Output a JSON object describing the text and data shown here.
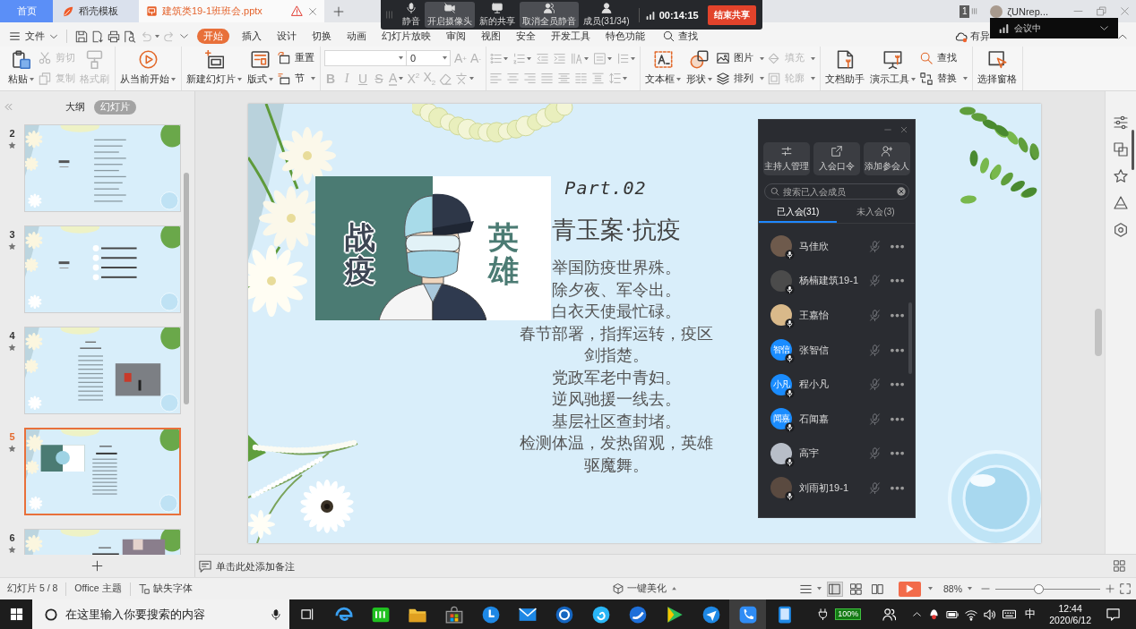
{
  "tabs": [
    {
      "kind": "home",
      "label": "首页",
      "selected": false,
      "warning": false
    },
    {
      "kind": "template",
      "label": "稻壳模板",
      "selected": false,
      "warning": false
    },
    {
      "kind": "document",
      "label": "建筑类19-1班班会.pptx",
      "selected": true,
      "warning": true
    }
  ],
  "account": {
    "badge": "1",
    "name": "ζUNrep..."
  },
  "meeting_bar": {
    "buttons": [
      {
        "label": "静音",
        "active": false
      },
      {
        "label": "开启摄像头",
        "active": true
      },
      {
        "label": "新的共享",
        "active": false
      },
      {
        "label": "取消全员静音",
        "active": true
      },
      {
        "label": "成员(31/34)",
        "active": false
      }
    ],
    "timer": "00:14:15",
    "end_button": "结束共享"
  },
  "meeting_status": "会议中",
  "menu": {
    "file": "文件",
    "quick_access": [
      {
        "disabled": false,
        "dropdown": false
      },
      {
        "disabled": false,
        "dropdown": false
      },
      {
        "disabled": false,
        "dropdown": false
      },
      {
        "disabled": false,
        "dropdown": false
      },
      {
        "disabled": true,
        "dropdown": true
      },
      {
        "disabled": true,
        "dropdown": false
      },
      {
        "disabled": false,
        "dropdown": false
      }
    ],
    "tabs": [
      {
        "label": "开始",
        "selected": true
      },
      {
        "label": "插入",
        "selected": false
      },
      {
        "label": "设计",
        "selected": false
      },
      {
        "label": "切换",
        "selected": false
      },
      {
        "label": "动画",
        "selected": false
      },
      {
        "label": "幻灯片放映",
        "selected": false
      },
      {
        "label": "审阅",
        "selected": false
      },
      {
        "label": "视图",
        "selected": false
      },
      {
        "label": "安全",
        "selected": false
      },
      {
        "label": "开发工具",
        "selected": false
      },
      {
        "label": "特色功能",
        "selected": false
      }
    ],
    "search": "查找",
    "cloud": "有异"
  },
  "ribbon": {
    "groups": [
      {
        "kind": "buttons",
        "items": [
          {
            "kind": "large",
            "label": "粘贴",
            "dropdown": true,
            "disabled": false
          },
          {
            "kind": "small",
            "label": "剪切",
            "dropdown": false,
            "disabled": true
          },
          {
            "kind": "small",
            "label": "复制",
            "dropdown": false,
            "disabled": true
          },
          {
            "kind": "large",
            "label": "格式刷",
            "dropdown": false,
            "disabled": true
          }
        ]
      },
      {
        "kind": "buttons",
        "items": [
          {
            "kind": "large",
            "label": "从当前开始",
            "dropdown": true,
            "disabled": false
          }
        ]
      },
      {
        "kind": "buttons",
        "items": [
          {
            "kind": "large",
            "label": "新建幻灯片",
            "dropdown": true,
            "disabled": false
          },
          {
            "kind": "large",
            "label": "版式",
            "dropdown": true,
            "disabled": false
          },
          {
            "kind": "small",
            "label": "重置",
            "dropdown": false,
            "disabled": false
          },
          {
            "kind": "small",
            "label": "节",
            "dropdown": true,
            "disabled": false
          }
        ]
      },
      {
        "kind": "font",
        "size": "0",
        "size_buttons": [
          {
            "label": "A$^{+}$",
            "disabled": true
          },
          {
            "label": "A$^{-}$",
            "disabled": true
          }
        ],
        "styles": [
          {
            "kind": "text",
            "label": "B",
            "dropdown": false,
            "disabled": true
          },
          {
            "kind": "text",
            "label": "I",
            "dropdown": false,
            "disabled": true
          },
          {
            "kind": "text",
            "label": "U",
            "dropdown": false,
            "disabled": true
          },
          {
            "kind": "text",
            "label": "S",
            "dropdown": false,
            "disabled": true
          },
          {
            "kind": "text",
            "label": "A",
            "dropdown": true,
            "disabled": true
          },
          {
            "kind": "text",
            "label": "X$^{2}$",
            "dropdown": false,
            "disabled": true
          },
          {
            "kind": "text",
            "label": "X$_{2}$",
            "dropdown": false,
            "disabled": true
          },
          {
            "kind": "icon",
            "dropdown": false,
            "disabled": true
          },
          {
            "kind": "icon",
            "dropdown": true,
            "disabled": true
          }
        ]
      },
      {
        "kind": "paragraph",
        "rows": [
          [
            {
              "dropdown": true,
              "disabled": true
            },
            {
              "dropdown": true,
              "disabled": true
            },
            {
              "dropdown": false,
              "disabled": true
            },
            {
              "dropdown": false,
              "disabled": true
            },
            {
              "dropdown": true,
              "disabled": true
            },
            {
              "dropdown": true,
              "disabled": true
            },
            {
              "dropdown": true,
              "disabled": true
            }
          ],
          [
            {
              "dropdown": false,
              "disabled": true
            },
            {
              "dropdown": false,
              "disabled": true
            },
            {
              "dropdown": false,
              "disabled": true
            },
            {
              "dropdown": false,
              "disabled": true
            },
            {
              "dropdown": false,
              "disabled": true
            },
            {
              "dropdown": false,
              "disabled": true
            },
            {
              "dropdown": false,
              "disabled": true
            },
            {
              "dropdown": true,
              "disabled": true
            }
          ]
        ]
      },
      {
        "kind": "buttons",
        "items": [
          {
            "kind": "large",
            "label": "文本框",
            "dropdown": true,
            "disabled": false
          },
          {
            "kind": "large",
            "label": "形状",
            "dropdown": true,
            "disabled": false
          },
          {
            "kind": "small",
            "label": "图片",
            "dropdown": true,
            "disabled": false
          },
          {
            "kind": "small",
            "label": "排列",
            "dropdown": true,
            "disabled": false
          },
          {
            "kind": "small",
            "label": "填充",
            "dropdown": true,
            "disabled": true
          },
          {
            "kind": "small",
            "label": "轮廓",
            "dropdown": true,
            "disabled": true
          }
        ]
      },
      {
        "kind": "buttons",
        "items": [
          {
            "kind": "large",
            "label": "文档助手",
            "dropdown": false,
            "disabled": false
          },
          {
            "kind": "large",
            "label": "演示工具",
            "dropdown": true,
            "disabled": false
          },
          {
            "kind": "small",
            "label": "查找",
            "dropdown": false,
            "disabled": false
          },
          {
            "kind": "small",
            "label": "替换",
            "dropdown": true,
            "disabled": false
          }
        ]
      },
      {
        "kind": "buttons",
        "items": [
          {
            "kind": "large",
            "label": "选择窗格",
            "dropdown": false,
            "disabled": false
          }
        ]
      }
    ]
  },
  "outline_panel": {
    "tabs": [
      {
        "label": "大纲",
        "selected": false
      },
      {
        "label": "幻灯片",
        "selected": true
      }
    ],
    "slides": [
      {
        "number": "2",
        "selected": false
      },
      {
        "number": "3",
        "selected": false
      },
      {
        "number": "4",
        "selected": false
      },
      {
        "number": "5",
        "selected": true
      },
      {
        "number": "6",
        "selected": false
      }
    ]
  },
  "slide": {
    "poster_text": [
      "战疫",
      "英雄"
    ],
    "part": "Part.02",
    "title": "青玉案·抗疫",
    "poem": [
      "举国防疫世界殊。",
      "除夕夜、军令出。",
      "白衣天使最忙碌。",
      "春节部署，指挥运转，疫区剑指楚。",
      "党政军老中青妇。",
      "逆风驰援一线去。",
      "基层社区查封堵。",
      "检测体温，发热留观，英雄驱魔舞。"
    ]
  },
  "members_panel": {
    "actions": [
      "主持人管理",
      "入会口令",
      "添加参会人"
    ],
    "search": {
      "placeholder": "搜索已入会成员"
    },
    "tabs": [
      {
        "label": "已入会(31)",
        "selected": true
      },
      {
        "label": "未入会(3)",
        "selected": false
      }
    ],
    "members": [
      {
        "kind": "photo",
        "name": "马佳欣",
        "muted": true
      },
      {
        "kind": "photo",
        "name": "杨楠建筑19-1",
        "muted": true
      },
      {
        "kind": "photo",
        "name": "王嘉怡",
        "muted": true
      },
      {
        "kind": "initials",
        "initials": "智信",
        "name": "张智信",
        "muted": true
      },
      {
        "kind": "initials",
        "initials": "小凡",
        "name": "程小凡",
        "muted": true
      },
      {
        "kind": "initials",
        "initials": "闻嘉",
        "name": "石闻嘉",
        "muted": true
      },
      {
        "kind": "photo",
        "name": "高宇",
        "muted": true
      },
      {
        "kind": "photo",
        "name": "刘雨初19-1",
        "muted": true
      }
    ]
  },
  "notes": {
    "placeholder": "单击此处添加备注"
  },
  "status_bar": {
    "slide_counter": "幻灯片 5 / 8",
    "theme": "Office 主题",
    "missing_fonts": "缺失字体",
    "beautify": "一键美化",
    "views": [
      {
        "selected": true
      },
      {
        "selected": false
      },
      {
        "selected": false
      }
    ],
    "zoom": "88%",
    "zoom_slider": {
      "level": 0.41
    }
  },
  "taskbar": {
    "search": {
      "placeholder": "在这里输入你要搜索的内容"
    },
    "apps": [
      {
        "selected": false
      },
      {
        "selected": false
      },
      {
        "selected": false
      },
      {
        "selected": false
      },
      {
        "selected": false
      },
      {
        "selected": false
      },
      {
        "selected": false
      },
      {
        "selected": false
      },
      {
        "selected": false
      },
      {
        "selected": false
      },
      {
        "selected": false
      },
      {
        "selected": true
      },
      {
        "selected": false
      }
    ],
    "battery": "100%",
    "input_method": "中",
    "time": "12:44",
    "date": "2020/6/12"
  }
}
